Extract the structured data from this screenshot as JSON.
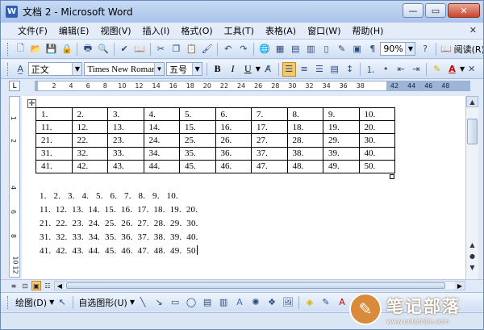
{
  "window": {
    "title": "文档 2 - Microsoft Word",
    "app_icon": "W"
  },
  "menu": {
    "items": [
      "文件(F)",
      "编辑(E)",
      "视图(V)",
      "插入(I)",
      "格式(O)",
      "工具(T)",
      "表格(A)",
      "窗口(W)",
      "帮助(H)"
    ]
  },
  "standard_toolbar": {
    "zoom": "90%",
    "read_label": "阅读(R)"
  },
  "format_toolbar": {
    "style": "正文",
    "font": "Times New Roman",
    "size": "五号",
    "bold": "B",
    "italic": "I",
    "underline": "U",
    "font_color_label": "A"
  },
  "ruler": {
    "ticks": [
      "2",
      "4",
      "6",
      "8",
      "10",
      "12",
      "14",
      "16",
      "18",
      "20",
      "22",
      "24",
      "26",
      "28",
      "30",
      "32",
      "34",
      "36",
      "38",
      "42",
      "44",
      "46",
      "48"
    ],
    "vticks": [
      "1",
      "2",
      "4",
      "6",
      "8",
      "10",
      "12"
    ]
  },
  "document": {
    "table_rows": [
      [
        "1.",
        "2.",
        "3.",
        "4.",
        "5.",
        "6.",
        "7.",
        "8.",
        "9.",
        "10."
      ],
      [
        "11.",
        "12.",
        "13.",
        "14.",
        "15.",
        "16.",
        "17.",
        "18.",
        "19.",
        "20."
      ],
      [
        "21.",
        "22.",
        "23.",
        "24.",
        "25.",
        "26.",
        "27.",
        "28.",
        "29.",
        "30."
      ],
      [
        "31.",
        "32.",
        "33.",
        "34.",
        "35.",
        "36.",
        "37.",
        "38.",
        "39.",
        "40."
      ],
      [
        "41.",
        "42.",
        "43.",
        "44.",
        "45.",
        "46.",
        "47.",
        "48.",
        "49.",
        "50."
      ]
    ],
    "plain_lines": [
      "1.   2.   3.   4.   5.   6.   7.   8.   9.   10.",
      "11.  12.  13.  14.  15.  16.  17.  18.  19.  20.",
      "21.  22.  23.  24.  25.  26.  27.  28.  29.  30.",
      "31.  32.  33.  34.  35.  36.  37.  38.  39.  40.",
      "41.  42.  43.  44.  45.  46.  47.  48.  49.  50"
    ]
  },
  "drawing_toolbar": {
    "draw_label": "绘图(D)",
    "autoshapes_label": "自选图形(U)"
  },
  "watermark": {
    "title": "笔记部落",
    "url": "www.notetribe.com"
  }
}
